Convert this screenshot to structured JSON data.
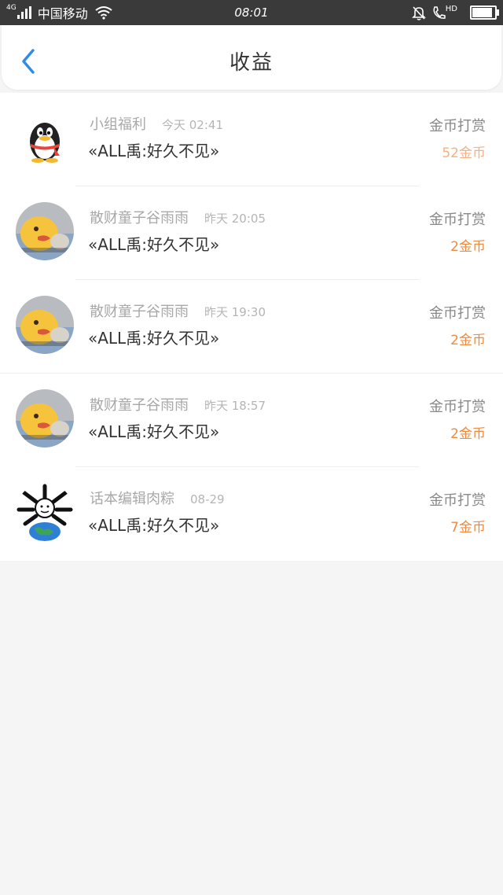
{
  "status_bar": {
    "network_type": "4G",
    "carrier": "中国移动",
    "time": "08:01",
    "call_badge": "HD",
    "battery_level": 0.95
  },
  "header": {
    "title": "收益",
    "back_icon": "chevron-left-icon"
  },
  "colors": {
    "accent_blue": "#2d8ce6",
    "amount_orange": "#f08a3e",
    "amount_orange_light": "#f3b186"
  },
  "rewards": [
    {
      "name": "小组福利",
      "date": "今天 02:41",
      "article": "«ALL禹:好久不见»",
      "type": "金币打赏",
      "amount": "52金币",
      "avatar": "penguin"
    },
    {
      "name": "散财童子谷雨雨",
      "date": "昨天 20:05",
      "article": "«ALL禹:好久不见»",
      "type": "金币打赏",
      "amount": "2金币",
      "avatar": "duck"
    },
    {
      "name": "散财童子谷雨雨",
      "date": "昨天 19:30",
      "article": "«ALL禹:好久不见»",
      "type": "金币打赏",
      "amount": "2金币",
      "avatar": "duck"
    },
    {
      "name": "散财童子谷雨雨",
      "date": "昨天 18:57",
      "article": "«ALL禹:好久不见»",
      "type": "金币打赏",
      "amount": "2金币",
      "avatar": "duck"
    },
    {
      "name": "话本编辑肉粽",
      "date": "08-29",
      "article": "«ALL禹:好久不见»",
      "type": "金币打赏",
      "amount": "7金币",
      "avatar": "bones-globe"
    }
  ]
}
